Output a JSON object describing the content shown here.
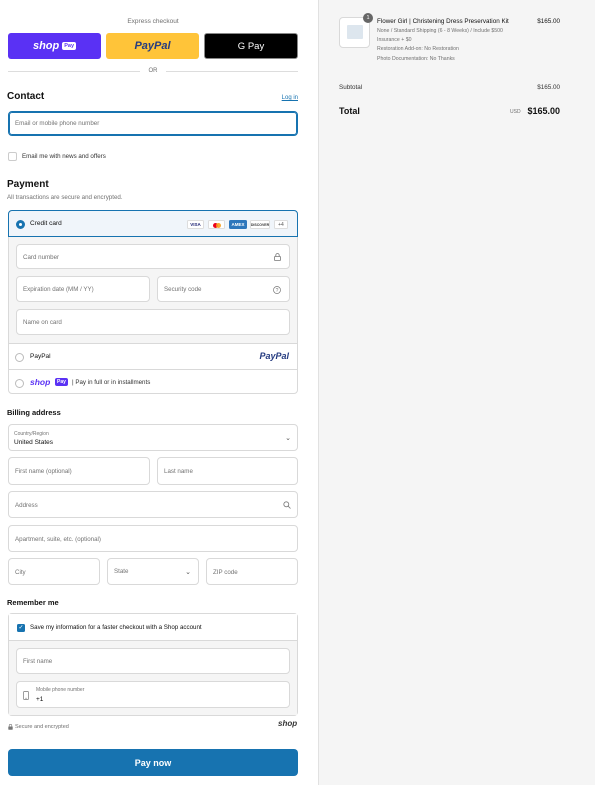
{
  "express": {
    "label": "Express checkout",
    "shoppay_text": "shop",
    "shoppay_badge": "Pay",
    "paypal_text": "PayPal",
    "gpay_text": "G Pay",
    "or_text": "OR"
  },
  "contact": {
    "heading": "Contact",
    "login_link": "Log in",
    "email_placeholder": "Email or mobile phone number",
    "news_label": "Email me with news and offers"
  },
  "payment": {
    "heading": "Payment",
    "subtitle": "All transactions are secure and encrypted.",
    "credit_card_label": "Credit card",
    "brands": [
      "VISA",
      "MC",
      "AMEX",
      "DISCOVER"
    ],
    "more_brands": "+4",
    "card_number_placeholder": "Card number",
    "expiration_placeholder": "Expiration date (MM / YY)",
    "security_code_placeholder": "Security code",
    "name_on_card_placeholder": "Name on card",
    "paypal_label": "PayPal",
    "paypal_logo": "PayPal",
    "shoppay_option_text": "shop",
    "shoppay_option_badge": "Pay",
    "shoppay_option_label": "| Pay in full or in installments"
  },
  "billing": {
    "heading": "Billing address",
    "country_label": "Country/Region",
    "country_value": "United States",
    "first_name_placeholder": "First name (optional)",
    "last_name_placeholder": "Last name",
    "address_placeholder": "Address",
    "apartment_placeholder": "Apartment, suite, etc. (optional)",
    "city_placeholder": "City",
    "state_placeholder": "State",
    "zip_placeholder": "ZIP code"
  },
  "remember": {
    "heading": "Remember me",
    "save_label": "Save my information for a faster checkout with a Shop account",
    "first_name_placeholder": "First name",
    "phone_label": "Mobile phone number",
    "phone_value": "+1",
    "secure_label": "Secure and encrypted",
    "shop_logo": "shop"
  },
  "pay_button": "Pay now",
  "summary": {
    "item_quantity": "1",
    "item_title": "Flower Girl | Christening Dress Preservation Kit",
    "item_price": "$165.00",
    "item_details": [
      "None / Standard Shipping (6 - 8 Weeks) / Include $500",
      "Insurance + $0",
      "Restoration Add-on: No Restoration",
      "Photo Documentation: No Thanks"
    ],
    "subtotal_label": "Subtotal",
    "subtotal_value": "$165.00",
    "total_label": "Total",
    "currency": "USD",
    "total_value": "$165.00"
  },
  "colors": {
    "accent": "#1773b0",
    "shoppay": "#5a31f4",
    "paypal": "#ffc439"
  }
}
